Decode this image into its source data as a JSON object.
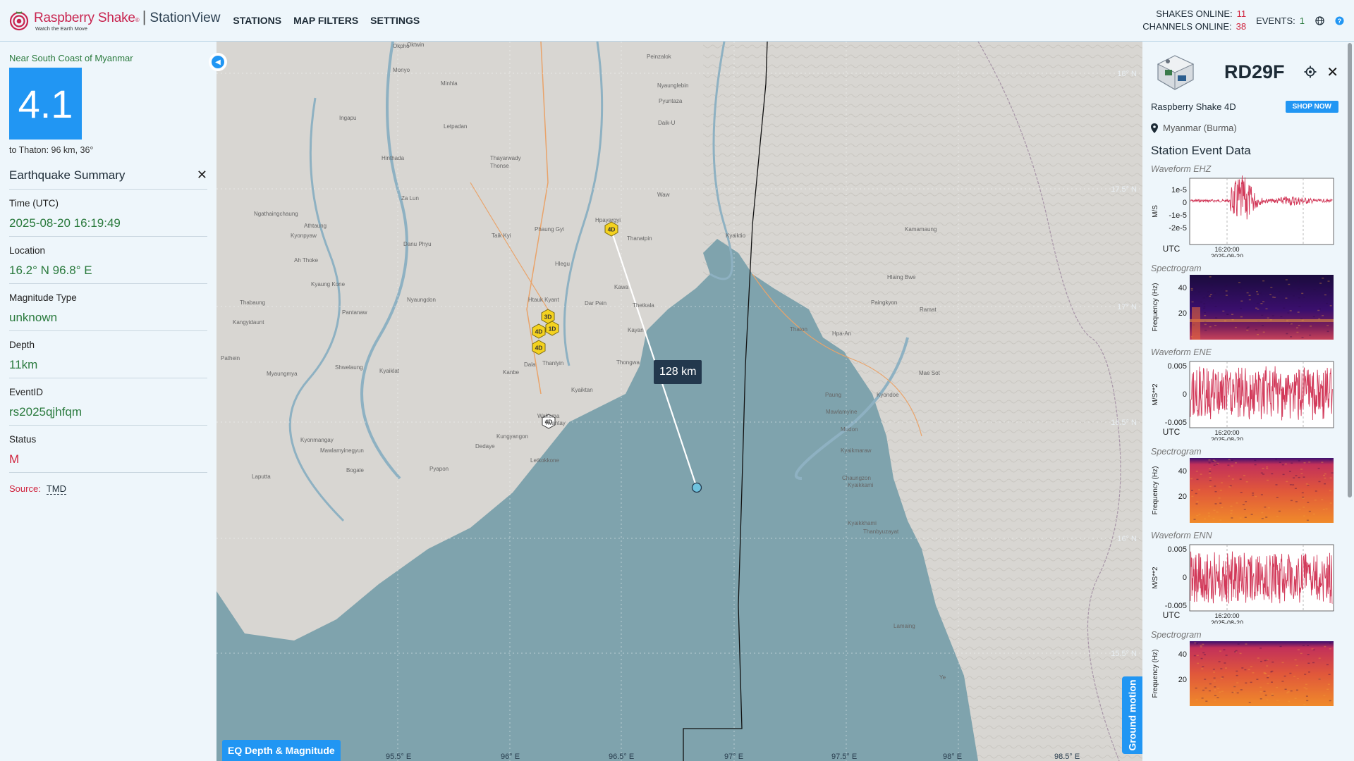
{
  "header": {
    "brand_name": "Raspberry Shake",
    "brand_mark": "®",
    "brand_app": "StationView",
    "brand_tagline": "Watch the Earth Move",
    "nav": [
      "STATIONS",
      "MAP FILTERS",
      "SETTINGS"
    ],
    "shakes_online_label": "SHAKES ONLINE:",
    "shakes_online": "11",
    "channels_online_label": "CHANNELS ONLINE:",
    "channels_online": "38",
    "events_label": "EVENTS:",
    "events": "1",
    "icons": [
      "globe-icon",
      "help-icon"
    ]
  },
  "event": {
    "region": "Near South Coast of Myanmar",
    "magnitude": "4.1",
    "to_place": "to Thaton: 96 km, 36°",
    "summary_title": "Earthquake Summary",
    "fields": [
      {
        "label": "Time (UTC)",
        "value": "2025-08-20 16:19:49"
      },
      {
        "label": "Location",
        "value": "16.2° N 96.8° E"
      },
      {
        "label": "Magnitude Type",
        "value": "unknown"
      },
      {
        "label": "Depth",
        "value": "11km"
      },
      {
        "label": "EventID",
        "value": "rs2025qjhfqm"
      },
      {
        "label": "Status",
        "value": "M"
      }
    ],
    "source_label": "Source:",
    "source": "TMD"
  },
  "map": {
    "distance": "128 km",
    "eq_button": "EQ Depth & Magnitude",
    "ground_motion": "Ground motion",
    "lon_labels": [
      "95.5° E",
      "96° E",
      "96.5° E",
      "97° E",
      "97.5° E",
      "98° E",
      "98.5° E"
    ],
    "lat_labels": [
      "18° N",
      "17.5° N",
      "17° N",
      "16.5° N",
      "16° N",
      "15.5° N"
    ],
    "markers": [
      {
        "label": "4D",
        "color": "#f4d21f"
      },
      {
        "label": "3D",
        "color": "#f4d21f"
      },
      {
        "label": "1D",
        "color": "#f4d21f"
      },
      {
        "label": "4D",
        "color": "#f4d21f"
      },
      {
        "label": "4D",
        "color": "#f4d21f"
      },
      {
        "label": "4D",
        "color": "#ffffff"
      }
    ],
    "towns": [
      "Oktwin",
      "Okpho",
      "Peinzalok",
      "Monyo",
      "Minhla",
      "Nyaunglebin",
      "Pyuntaza",
      "Daik-U",
      "Ingapu",
      "Letpadan",
      "Hinthada",
      "Thayarwady",
      "Thonse",
      "Za Lun",
      "Waw",
      "Hpayargyi",
      "Ngathaingchaung",
      "Athtaung",
      "Kyonpyaw",
      "Taik Kyi",
      "Phaung Gyi",
      "Thanatpin",
      "Danu Phyu",
      "Kyaiktio",
      "Kamamaung",
      "Ah Thoke",
      "Kyaung Kone",
      "Hlegu",
      "Kawa",
      "Hlaing Bwe",
      "Thabaung",
      "Nyaungdon",
      "Dar Pein",
      "Thetkala",
      "Paingkyon",
      "Kangyidaunt",
      "Htauk Kyant",
      "Pantanaw",
      "Kayan",
      "Thaton",
      "Hpa-An",
      "Ramat",
      "Pathein",
      "Shwelaung",
      "Myaungmya",
      "Kyaiklat",
      "Kanbe",
      "Dala",
      "Thanlyin",
      "Thongwa",
      "Kyaiktan",
      "Paung",
      "Kyondoe",
      "Mawlamyine",
      "Mae Sot",
      "Wakema",
      "Twantay",
      "Kyonmangay",
      "Mawlamyinegyun",
      "Dedaye",
      "Kungyangon",
      "Mudon",
      "Kyaikmaraw",
      "Bogale",
      "Pyapon",
      "Kyaikkami",
      "Chaungzon",
      "Laputta",
      "Letkokkone",
      "Thanbyuzayat",
      "Kyaikkhami",
      "Lamaing",
      "Ye"
    ]
  },
  "station": {
    "id": "RD29F",
    "model": "Raspberry Shake 4D",
    "shop_label": "SHOP NOW",
    "location": "Myanmar (Burma)",
    "section_title": "Station Event Data",
    "blocks": [
      {
        "kind": "waveform",
        "label": "Waveform EHZ",
        "ylabel": "M/S",
        "ticks": [
          "1e-5",
          "0",
          "-1e-5",
          "-2e-5"
        ],
        "utc": "UTC",
        "time": "16:20:00",
        "date": "2025-08-20"
      },
      {
        "kind": "spectrogram",
        "label": "Spectrogram",
        "ylabel": "Frequency (Hz)",
        "ticks": [
          "40",
          "20"
        ]
      },
      {
        "kind": "waveform",
        "label": "Waveform ENE",
        "ylabel": "M/S**2",
        "ticks": [
          "0.005",
          "0",
          "-0.005"
        ],
        "utc": "UTC",
        "time": "16:20:00",
        "date": "2025-08-20"
      },
      {
        "kind": "spectrogram",
        "label": "Spectrogram",
        "ylabel": "Frequency (Hz)",
        "ticks": [
          "40",
          "20"
        ]
      },
      {
        "kind": "waveform",
        "label": "Waveform ENN",
        "ylabel": "M/S**2",
        "ticks": [
          "0.005",
          "0",
          "-0.005"
        ],
        "utc": "UTC",
        "time": "16:20:00",
        "date": "2025-08-20"
      },
      {
        "kind": "spectrogram",
        "label": "Spectrogram",
        "ylabel": "Frequency (Hz)",
        "ticks": [
          "40",
          "20"
        ]
      }
    ]
  },
  "colors": {
    "accent": "#2196f3",
    "green_value": "#2a7a3d",
    "red_value": "#d0243e",
    "brand": "#c8234e",
    "waveform": "#d23a5a",
    "sea": "#7fa3ad",
    "land": "#d8d6d2"
  }
}
